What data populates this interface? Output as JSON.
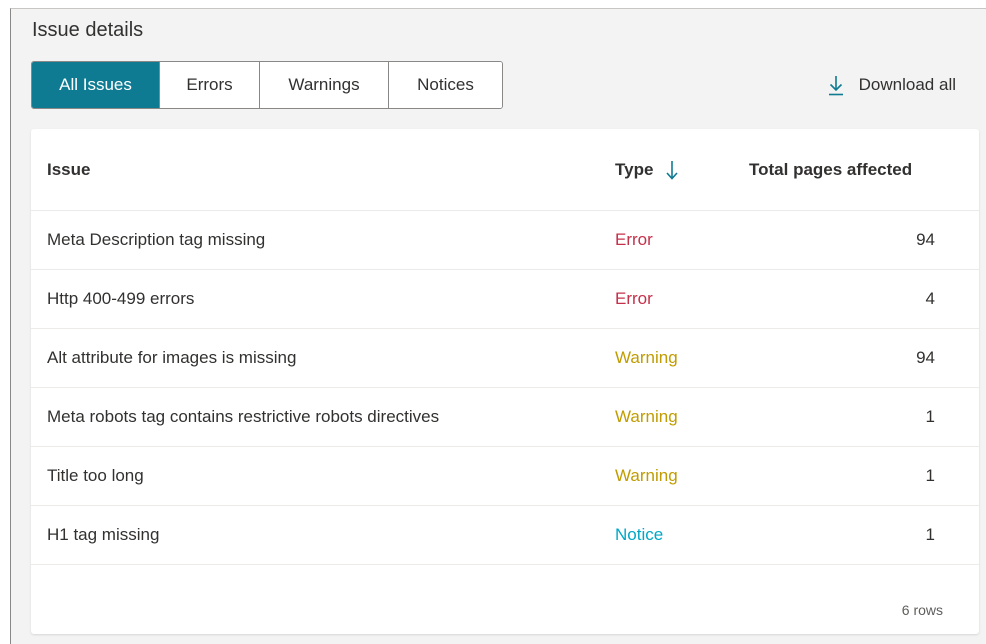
{
  "heading": "Issue details",
  "tabs": [
    {
      "label": "All Issues",
      "active": true
    },
    {
      "label": "Errors",
      "active": false
    },
    {
      "label": "Warnings",
      "active": false
    },
    {
      "label": "Notices",
      "active": false
    }
  ],
  "download": {
    "label": "Download all",
    "icon": "download-icon"
  },
  "table": {
    "columns": {
      "issue": "Issue",
      "type": "Type",
      "pages": "Total pages affected"
    },
    "sort": {
      "column": "Type",
      "direction": "descending",
      "icon": "arrow-down-icon"
    },
    "rows": [
      {
        "issue": "Meta Description tag missing",
        "type": "Error",
        "pages": "94"
      },
      {
        "issue": "Http 400-499 errors",
        "type": "Error",
        "pages": "4"
      },
      {
        "issue": "Alt attribute for images is missing",
        "type": "Warning",
        "pages": "94"
      },
      {
        "issue": "Meta robots tag contains restrictive robots directives",
        "type": "Warning",
        "pages": "1"
      },
      {
        "issue": "Title too long",
        "type": "Warning",
        "pages": "1"
      },
      {
        "issue": "H1 tag missing",
        "type": "Notice",
        "pages": "1"
      }
    ],
    "footer": "6 rows"
  },
  "colors": {
    "accent": "#0f7b92",
    "error": "#c4314b",
    "warning": "#c19c00",
    "notice": "#00a8c6"
  }
}
